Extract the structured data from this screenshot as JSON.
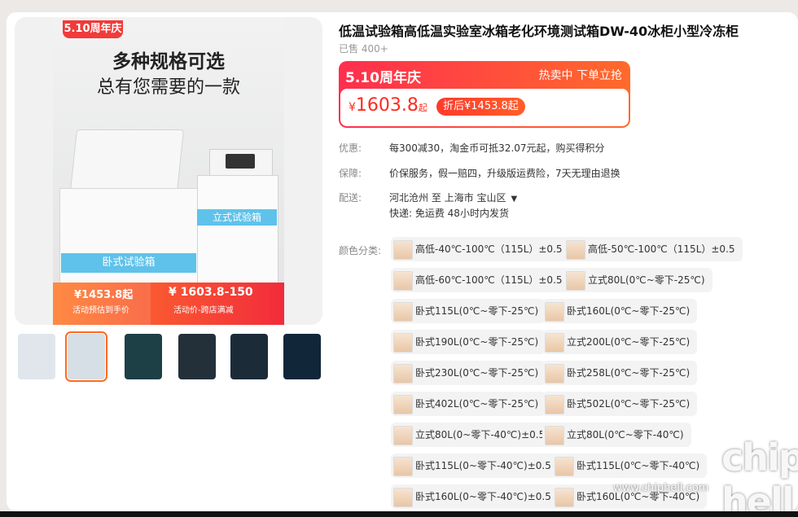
{
  "main_image": {
    "brand_tag": "5.10周年庆",
    "headline": "多种规格可选",
    "subheadline": "总有您需要的一款",
    "freezer_label": "卧式试验箱",
    "upright_label": "立式试验箱",
    "promo_price_1": "¥1453.8起",
    "promo_caption_1": "活动预估到手价",
    "promo_price_2": "¥ 1603.8-150",
    "promo_caption_2": "活动价-跨店满减"
  },
  "thumbnails": [
    {
      "name": "thumb-1",
      "color": "#e0e6ec"
    },
    {
      "name": "thumb-2",
      "color": "#d6dee6"
    },
    {
      "name": "thumb-3",
      "color": "#1d3f46"
    },
    {
      "name": "thumb-4",
      "color": "#23303a"
    },
    {
      "name": "thumb-5",
      "color": "#1b2b38"
    },
    {
      "name": "thumb-6",
      "color": "#12263a"
    }
  ],
  "product": {
    "title": "低温试验箱高低温实验室冰箱老化环境测试箱DW-40冰柜小型冷冻柜",
    "sold": "已售 400+"
  },
  "price": {
    "event": "5.10周年庆",
    "hot": "热卖中 下单立抢",
    "yen": "¥",
    "amount": "1603.8",
    "suffix": "起",
    "discount": "折后¥1453.8起"
  },
  "info": {
    "promo_label": "优惠:",
    "promo_value": "每300减30，淘金币可抵32.07元起，购买得积分",
    "guarantee_label": "保障:",
    "guarantee_value": "价保服务，假一赔四，升级版运费险，7天无理由退换",
    "delivery_label": "配送:",
    "delivery_route": "河北沧州   至   上海市     宝山区",
    "delivery_extra": "快递: 免运费   48小时内发货"
  },
  "options_label": "颜色分类:",
  "options": [
    "高低-40℃-100℃（115L）±0.5",
    "高低-50℃-100℃（115L）±0.5",
    "高低-60℃-100℃（115L）±0.5",
    "立式80L(0℃~零下-25℃)",
    "卧式115L(0℃~零下-25℃)",
    "卧式160L(0℃~零下-25℃)",
    "卧式190L(0℃~零下-25℃)",
    "立式200L(0℃~零下-25℃)",
    "卧式230L(0℃~零下-25℃)",
    "卧式258L(0℃~零下-25℃)",
    "卧式402L(0℃~零下-25℃)",
    "卧式502L(0℃~零下-25℃)",
    "立式80L(0~零下-40℃)±0.5",
    "立式80L(0℃~零下-40℃)",
    "卧式115L(0~零下-40℃)±0.5",
    "卧式115L(0℃~零下-40℃)",
    "卧式160L(0~零下-40℃)±0.5",
    "卧式160L(0℃~零下-40℃)"
  ],
  "watermark": {
    "url": "www.chiphell.com",
    "logo": "chip hell"
  }
}
